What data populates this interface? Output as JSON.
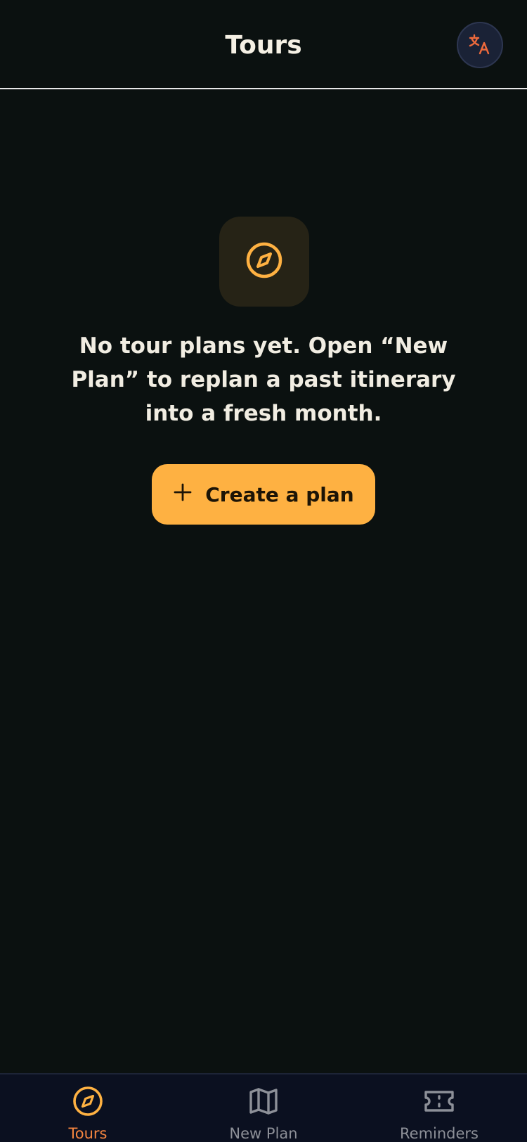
{
  "header": {
    "title": "Tours",
    "language_icon": "translate-icon"
  },
  "empty_state": {
    "icon": "compass-icon",
    "message": "No tour plans yet. Open “New Plan” to replan a past itinerary into a fresh month.",
    "button_label": "Create a plan",
    "button_icon": "plus-icon"
  },
  "tabs": [
    {
      "label": "Tours",
      "icon": "compass-icon",
      "active": true
    },
    {
      "label": "New Plan",
      "icon": "map-icon",
      "active": false
    },
    {
      "label": "Reminders",
      "icon": "ticket-icon",
      "active": false
    }
  ],
  "colors": {
    "background": "#0b1110",
    "accent": "#feb142",
    "active_tab_label": "#f5853f",
    "inactive_tab": "#8d9098",
    "text": "#f1ede2"
  }
}
